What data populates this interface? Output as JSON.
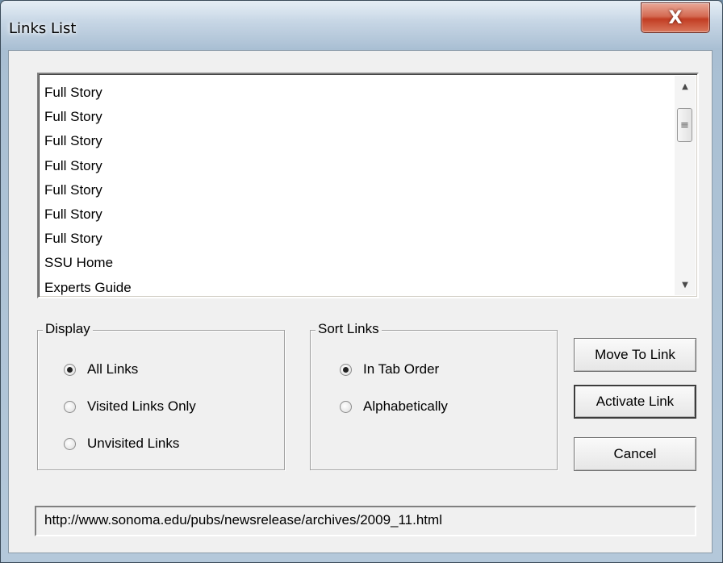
{
  "window": {
    "title": "Links List",
    "close_glyph": "X"
  },
  "links": [
    "Full Story",
    "Full Story",
    "Full Story",
    "Full Story",
    "Full Story",
    "Full Story",
    "Full Story",
    "SSU Home",
    "Experts Guide"
  ],
  "scrollbar": {
    "up_glyph": "▲",
    "down_glyph": "▼",
    "thumb_glyph": "≡"
  },
  "display_group": {
    "label": "Display",
    "options": [
      {
        "label": "All Links",
        "checked": true
      },
      {
        "label": "Visited Links Only",
        "checked": false
      },
      {
        "label": "Unvisited Links",
        "checked": false
      }
    ]
  },
  "sort_group": {
    "label": "Sort Links",
    "options": [
      {
        "label": "In Tab Order",
        "checked": true
      },
      {
        "label": "Alphabetically",
        "checked": false
      }
    ]
  },
  "buttons": {
    "move_to_link": "Move To Link",
    "activate_link": "Activate Link",
    "cancel": "Cancel"
  },
  "status_url": "http://www.sonoma.edu/pubs/newsrelease/archives/2009_11.html"
}
